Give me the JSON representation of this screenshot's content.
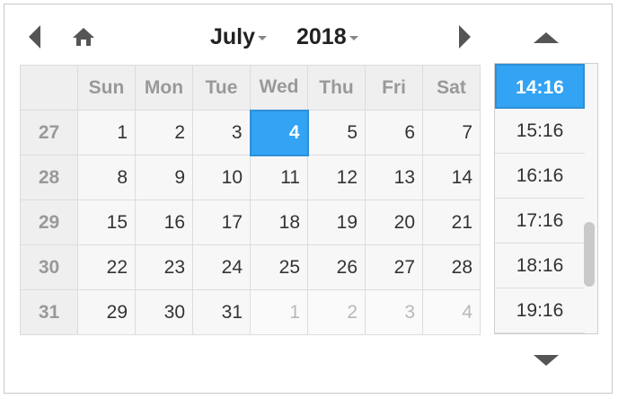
{
  "header": {
    "month": "July",
    "year": "2018"
  },
  "calendar": {
    "weekday_headers": [
      "Sun",
      "Mon",
      "Tue",
      "Wed",
      "Thu",
      "Fri",
      "Sat"
    ],
    "weeks": [
      {
        "week": "27",
        "days": [
          {
            "d": "1",
            "o": false
          },
          {
            "d": "2",
            "o": false
          },
          {
            "d": "3",
            "o": false
          },
          {
            "d": "4",
            "o": false,
            "sel": true
          },
          {
            "d": "5",
            "o": false
          },
          {
            "d": "6",
            "o": false
          },
          {
            "d": "7",
            "o": false
          }
        ]
      },
      {
        "week": "28",
        "days": [
          {
            "d": "8",
            "o": false
          },
          {
            "d": "9",
            "o": false
          },
          {
            "d": "10",
            "o": false
          },
          {
            "d": "11",
            "o": false
          },
          {
            "d": "12",
            "o": false
          },
          {
            "d": "13",
            "o": false
          },
          {
            "d": "14",
            "o": false
          }
        ]
      },
      {
        "week": "29",
        "days": [
          {
            "d": "15",
            "o": false
          },
          {
            "d": "16",
            "o": false
          },
          {
            "d": "17",
            "o": false
          },
          {
            "d": "18",
            "o": false
          },
          {
            "d": "19",
            "o": false
          },
          {
            "d": "20",
            "o": false
          },
          {
            "d": "21",
            "o": false
          }
        ]
      },
      {
        "week": "30",
        "days": [
          {
            "d": "22",
            "o": false
          },
          {
            "d": "23",
            "o": false
          },
          {
            "d": "24",
            "o": false
          },
          {
            "d": "25",
            "o": false
          },
          {
            "d": "26",
            "o": false
          },
          {
            "d": "27",
            "o": false
          },
          {
            "d": "28",
            "o": false
          }
        ]
      },
      {
        "week": "31",
        "days": [
          {
            "d": "29",
            "o": false
          },
          {
            "d": "30",
            "o": false
          },
          {
            "d": "31",
            "o": false
          },
          {
            "d": "1",
            "o": true
          },
          {
            "d": "2",
            "o": true
          },
          {
            "d": "3",
            "o": true
          },
          {
            "d": "4",
            "o": true
          }
        ]
      }
    ]
  },
  "time": {
    "items": [
      "14:16",
      "15:16",
      "16:16",
      "17:16",
      "18:16",
      "19:16"
    ],
    "selected": "14:16"
  },
  "colors": {
    "accent": "#33a3f4",
    "cell_bg": "#f7f7f7",
    "header_bg": "#efefef"
  },
  "icons": {
    "prev": "triangle-left-icon",
    "home": "home-icon",
    "next": "triangle-right-icon",
    "time_up": "triangle-up-icon",
    "time_down": "triangle-down-icon"
  }
}
